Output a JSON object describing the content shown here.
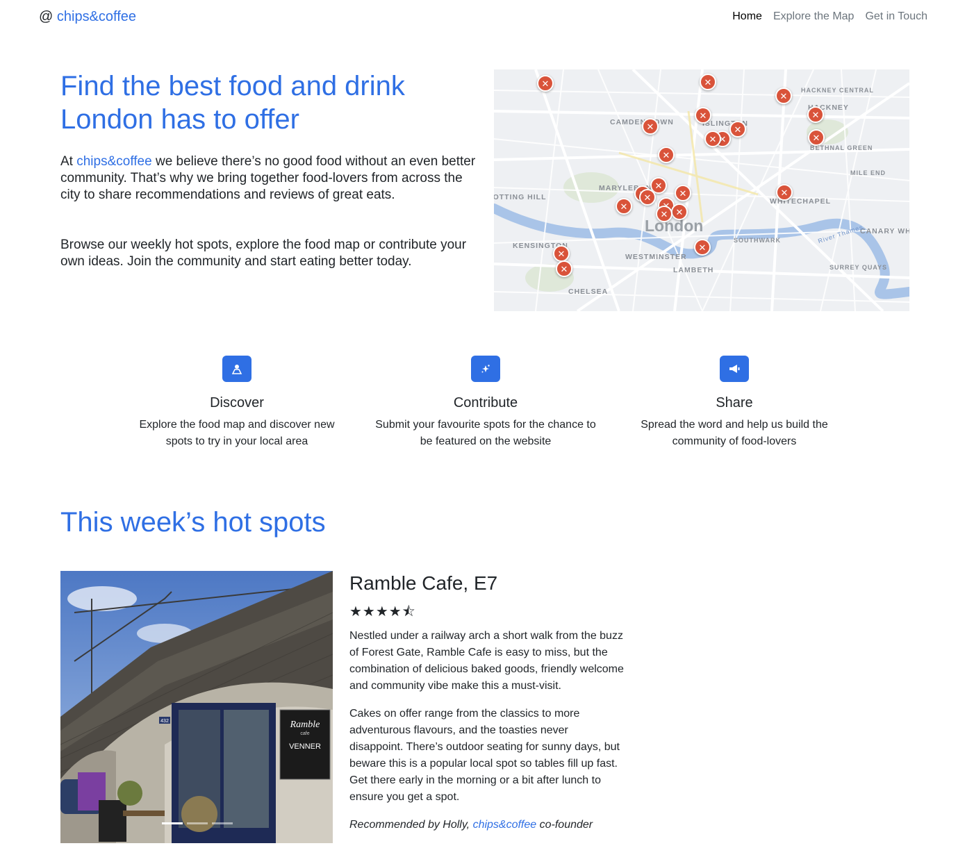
{
  "nav": {
    "brand_at": "@",
    "brand_name": "chips&coffee",
    "links": [
      {
        "label": "Home",
        "active": true
      },
      {
        "label": "Explore the Map",
        "active": false
      },
      {
        "label": "Get in Touch",
        "active": false
      }
    ]
  },
  "hero": {
    "title": "Find the best food and drink London has to offer",
    "p1_prefix": "At ",
    "p1_brand": "chips&coffee",
    "p1_suffix": " we believe there’s no good food without an even better community. That’s why we bring together food-lovers from across the city to share recommendations and reviews of great eats.",
    "p2": "Browse our weekly hot spots, explore the food map or contribute your own ideas. Join the community and start eating better today."
  },
  "map": {
    "city_label": "London",
    "area_labels": [
      "CAMDEN TOWN",
      "ISLINGTON",
      "HACKNEY CENTRAL",
      "HACKNEY",
      "BETHNAL GREEN",
      "MILE END",
      "MARYLEBONE",
      "NOTTING HILL",
      "WHITECHAPEL",
      "KENSINGTON",
      "WESTMINSTER",
      "SOUTHWARK",
      "LAMBETH",
      "CHELSEA",
      "CANARY WHARF",
      "SURREY QUAYS",
      "River Thames"
    ],
    "pin_icon": "fork-knife-icon",
    "pin_color": "#d9533a"
  },
  "features": [
    {
      "icon": "person-pin-icon",
      "title": "Discover",
      "desc": "Explore the food map and discover new spots to try in your local area"
    },
    {
      "icon": "sparkles-icon",
      "title": "Contribute",
      "desc": "Submit your favourite spots for the chance to be featured on the website"
    },
    {
      "icon": "megaphone-icon",
      "title": "Share",
      "desc": "Spread the word and help us build the community of food-lovers"
    }
  ],
  "hotspots": {
    "section_title": "This week’s hot spots",
    "card": {
      "title": "Ramble Cafe, E7",
      "rating": 4.5,
      "rating_display": "★★★★⯪",
      "p1": "Nestled under a railway arch a short walk from the buzz of Forest Gate, Ramble Cafe is easy to miss, but the combination of delicious baked goods, friendly welcome and community vibe make this a must-visit.",
      "p2": "Cakes on offer range from the classics to more adventurous flavours, and the toasties never disappoint. There’s outdoor seating for sunny days, but beware this is a popular local spot so tables fill up fast. Get there early in the morning or a bit after lunch to ensure you get a spot.",
      "credit_prefix": "Recommended by Holly, ",
      "credit_brand": "chips&coffee",
      "credit_suffix": " co-founder",
      "photo_sign_name": "Ramble",
      "photo_sign_sub": "cafe",
      "photo_sign_partner": "VENNER",
      "photo_number": "432"
    }
  },
  "colors": {
    "accent": "#2f6fe4",
    "pin": "#d9533a",
    "text": "#212529",
    "muted_nav": "#6c757d"
  }
}
